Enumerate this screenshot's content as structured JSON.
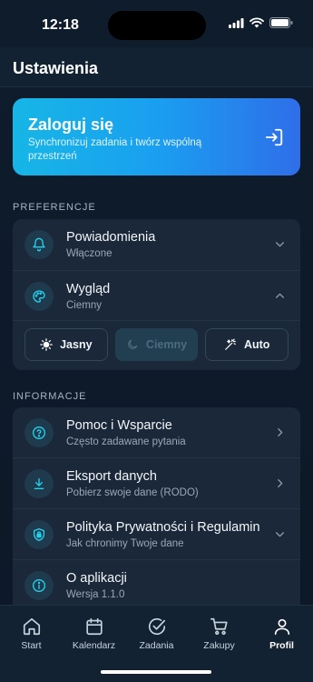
{
  "status": {
    "time": "12:18",
    "icons": [
      "signal-icon",
      "wifi-icon",
      "battery-icon"
    ]
  },
  "header": {
    "title": "Ustawienia"
  },
  "login": {
    "title": "Zaloguj się",
    "subtitle": "Synchronizuj zadania i twórz wspólną przestrzeń",
    "icon": "login-icon"
  },
  "sections": {
    "preferences": "PREFERENCJE",
    "info": "INFORMACJE"
  },
  "preferences": {
    "notifications": {
      "title": "Powiadomienia",
      "subtitle": "Włączone",
      "icon": "bell-icon"
    },
    "appearance": {
      "title": "Wygląd",
      "subtitle": "Ciemny",
      "icon": "palette-icon"
    },
    "themes": [
      {
        "label": "Jasny",
        "icon": "sun-icon"
      },
      {
        "label": "Ciemny",
        "icon": "moon-icon",
        "selected": true
      },
      {
        "label": "Auto",
        "icon": "auto-theme-icon"
      }
    ]
  },
  "info": {
    "help": {
      "title": "Pomoc i Wsparcie",
      "subtitle": "Często zadawane pytania",
      "icon": "help-icon"
    },
    "export": {
      "title": "Eksport danych",
      "subtitle": "Pobierz swoje dane (RODO)",
      "icon": "download-icon"
    },
    "privacy": {
      "title": "Polityka Prywatności i Regulamin",
      "subtitle": "Jak chronimy Twoje dane",
      "icon": "shield-lock-icon"
    },
    "about": {
      "title": "O aplikacji",
      "subtitle": "Wersja 1.1.0",
      "icon": "info-icon"
    }
  },
  "tabs": [
    {
      "label": "Start",
      "icon": "home-icon"
    },
    {
      "label": "Kalendarz",
      "icon": "calendar-icon"
    },
    {
      "label": "Zadania",
      "icon": "check-circle-icon"
    },
    {
      "label": "Zakupy",
      "icon": "cart-icon"
    },
    {
      "label": "Profil",
      "icon": "user-icon",
      "active": true
    }
  ],
  "colors": {
    "accent": "#22d3ee",
    "card": "#1a2839",
    "background": "#0f1b2b",
    "gradient_start": "#16b6e6",
    "gradient_end": "#2f6ee9"
  }
}
